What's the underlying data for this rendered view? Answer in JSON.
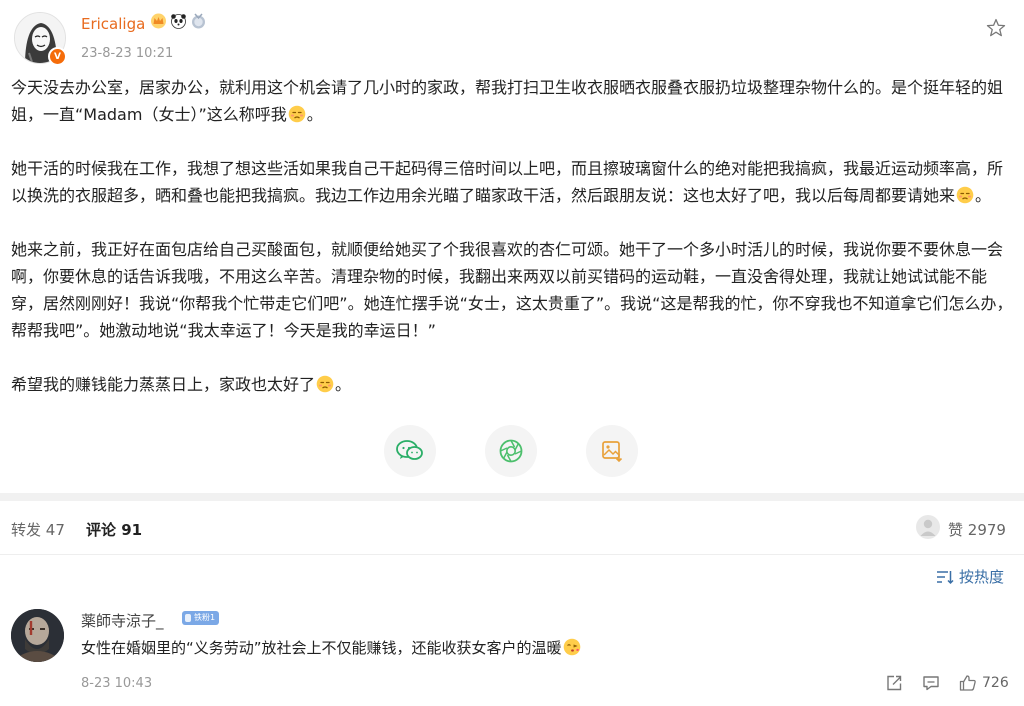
{
  "post": {
    "author": {
      "name": "Ericaliga",
      "badge_icons": [
        "crown-icon",
        "panda-icon",
        "medal-icon"
      ],
      "verified_mark": "V"
    },
    "time": "23-8-23 10:21",
    "paragraphs": [
      [
        "今天没去办公室，居家办公，就利用这个机会请了几小时的家政，帮我打扫卫生收衣服晒衣服叠衣服扔垃圾整理杂物什么的。是个挺年轻的姐姐，一直“Madam（女士）”这么称呼我",
        "。"
      ],
      [
        "她干活的时候我在工作，我想了想这些活如果我自己干起码得三倍时间以上吧，而且擦玻璃窗什么的绝对能把我搞疯，我最近运动频率高，所以换洗的衣服超多，晒和叠也能把我搞疯。我边工作边用余光瞄了瞄家政干活，然后跟朋友说：这也太好了吧，我以后每周都要请她来",
        "。"
      ],
      [
        "她来之前，我正好在面包店给自己买酸面包，就顺便给她买了个我很喜欢的杏仁可颂。她干了一个多小时活儿的时候，我说你要不要休息一会啊，你要休息的话告诉我哦，不用这么辛苦。清理杂物的时候，我翻出来两双以前买错码的运动鞋，一直没舍得处理，我就让她试试能不能穿，居然刚刚好！我说“你帮我个忙带走它们吧”。她连忙摆手说“女士，这太贵重了”。我说“这是帮我的忙，你不穿我也不知道拿它们怎么办，帮帮我吧”。她激动地说“我太幸运了！今天是我的幸运日！”"
      ],
      [
        "希望我的赚钱能力蒸蒸日上，家政也太好了",
        "。"
      ]
    ],
    "emoji": "sad-face-emoji",
    "share_icons": [
      "wechat-icon",
      "moments-icon",
      "save-image-icon"
    ]
  },
  "tabs": {
    "repost_label": "转发",
    "repost_count": "47",
    "comments_label": "评论",
    "comments_count": "91",
    "likes_label": "赞",
    "likes_count": "2979"
  },
  "sort": {
    "label": "按热度",
    "icon": "sort-lines-icon"
  },
  "comment": {
    "user": "薬師寺涼子_",
    "fan_badge": "铁粉1",
    "text": "女性在婚姻里的“义务劳动”放社会上不仅能赚钱，还能收获女客户的温暖",
    "text_emoji": "blush-kiss-emoji",
    "time": "8-23 10:43",
    "like_count": "726",
    "action_icons": [
      "share-icon",
      "reply-icon",
      "thumb-up-icon"
    ]
  },
  "colors": {
    "accent_orange": "#e86b1f",
    "link_blue": "#3a6fa6",
    "wechat_green": "#2aae67",
    "moments_green": "#4cbf6c",
    "image_orange": "#e8a13b"
  }
}
